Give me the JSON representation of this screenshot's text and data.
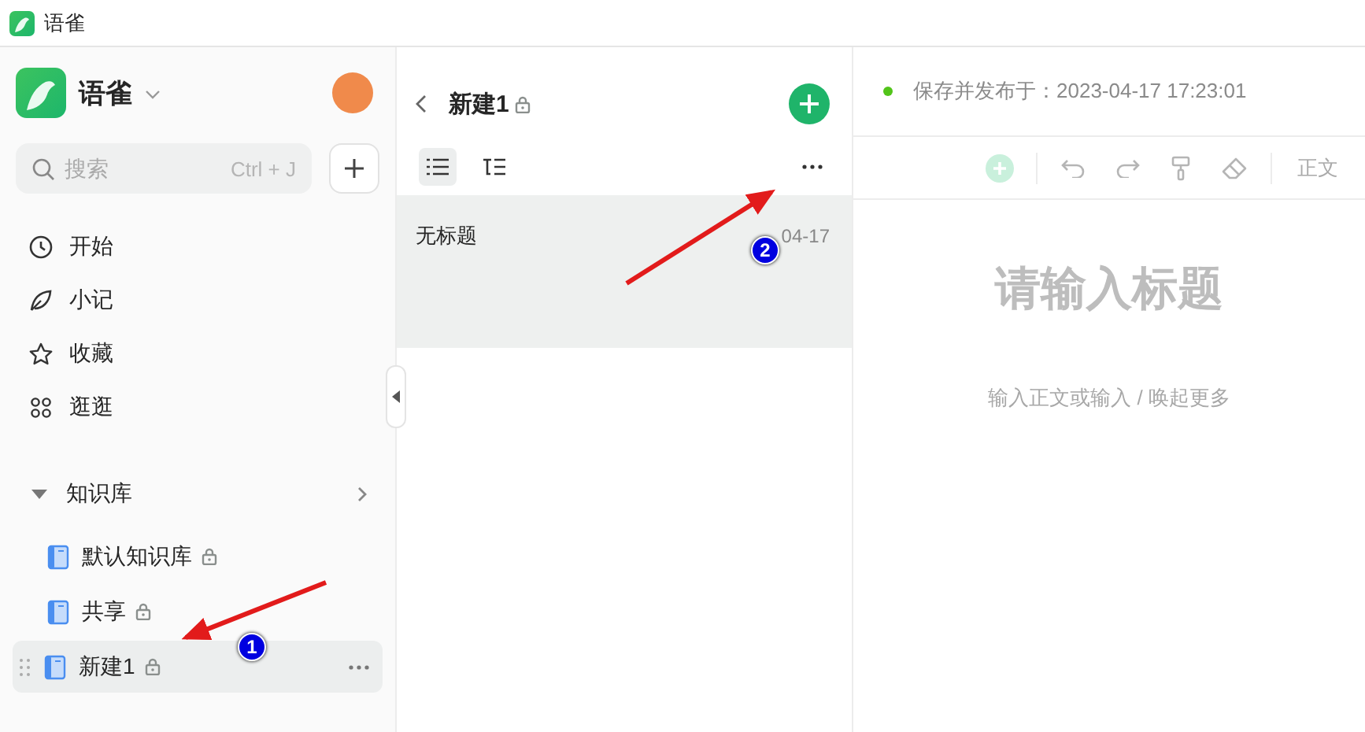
{
  "window": {
    "title": "语雀"
  },
  "sidebar": {
    "brand": "语雀",
    "search": {
      "placeholder": "搜索",
      "shortcut": "Ctrl + J"
    },
    "nav": [
      {
        "label": "开始",
        "kind": "clock"
      },
      {
        "label": "小记",
        "kind": "leaf"
      },
      {
        "label": "收藏",
        "kind": "star"
      },
      {
        "label": "逛逛",
        "kind": "grid"
      }
    ],
    "section": {
      "label": "知识库",
      "expanded": true
    },
    "libraries": [
      {
        "label": "默认知识库",
        "locked": true,
        "selected": false
      },
      {
        "label": "共享",
        "locked": true,
        "selected": false
      },
      {
        "label": "新建1",
        "locked": true,
        "selected": true
      }
    ]
  },
  "doc_list": {
    "title": "新建1",
    "locked": true,
    "views": [
      {
        "kind": "list",
        "selected": true
      },
      {
        "kind": "tree",
        "selected": false
      }
    ],
    "items": [
      {
        "title": "无标题",
        "date": "04-17",
        "selected": true
      }
    ]
  },
  "editor": {
    "status": "保存并发布于：2023-04-17 17:23:01",
    "style": "正文",
    "title_placeholder": "请输入标题",
    "body_placeholder": "输入正文或输入 / 唤起更多"
  },
  "annotations": [
    {
      "label": "1"
    },
    {
      "label": "2"
    }
  ]
}
